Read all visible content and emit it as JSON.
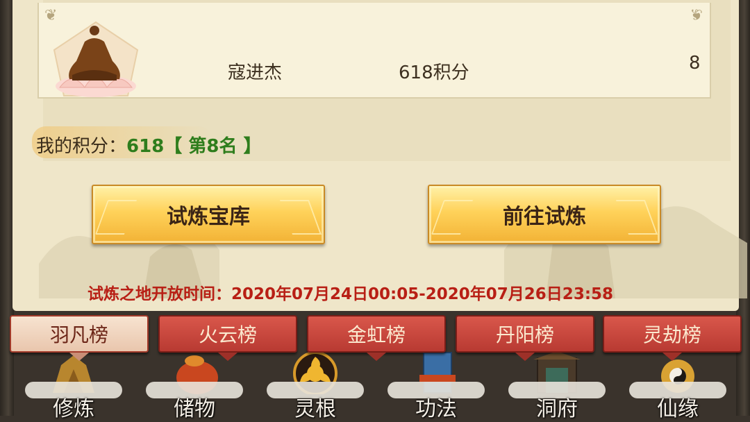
{
  "rank_entry": {
    "name": "寇进杰",
    "score": "618积分",
    "rank": "8",
    "avatar_icon": "lotus-immortal-icon"
  },
  "my_score": {
    "label": "我的积分：",
    "value": "618",
    "rank_text": "【 第8名 】"
  },
  "buttons": {
    "treasury": "试炼宝库",
    "go_trial": "前往试炼"
  },
  "open_time": "试炼之地开放时间：2020年07月24日00:05-2020年07月26日23:58",
  "tabs": [
    {
      "label": "羽凡榜",
      "active": true
    },
    {
      "label": "火云榜",
      "active": false
    },
    {
      "label": "金虹榜",
      "active": false
    },
    {
      "label": "丹阳榜",
      "active": false
    },
    {
      "label": "灵劫榜",
      "active": false
    }
  ],
  "dock": [
    {
      "label": "修炼",
      "icon": "cultivate-icon"
    },
    {
      "label": "储物",
      "icon": "storage-bag-icon"
    },
    {
      "label": "灵根",
      "icon": "spirit-root-icon"
    },
    {
      "label": "功法",
      "icon": "scroll-book-icon"
    },
    {
      "label": "洞府",
      "icon": "cave-dwelling-icon"
    },
    {
      "label": "仙缘",
      "icon": "immortal-fate-icon"
    }
  ],
  "colors": {
    "panel_bg": "#efe6c9",
    "score_green": "#2e7d1c",
    "time_red": "#b81f15",
    "tab_red": "#c8463d",
    "button_gold": "#ffd25a"
  }
}
